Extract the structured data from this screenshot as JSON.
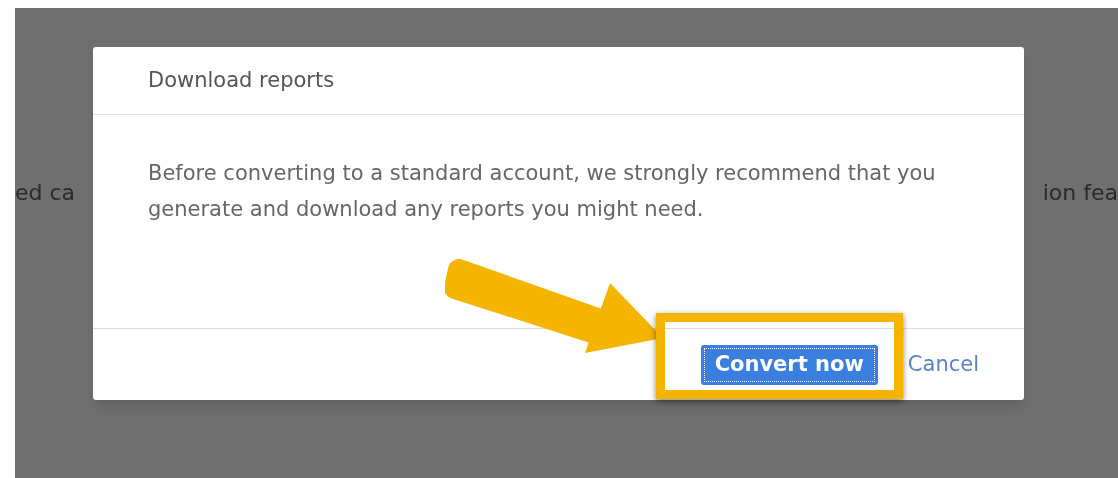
{
  "background_texts": [
    "ed ca",
    "ion fea"
  ],
  "dialog": {
    "title": "Download reports",
    "message": "Before converting to a standard account, we strongly recommend that you generate and download any reports you might need.",
    "buttons": [
      {
        "label": "Convert now",
        "kind": "primary"
      },
      {
        "label": "Cancel",
        "kind": "link"
      }
    ]
  }
}
